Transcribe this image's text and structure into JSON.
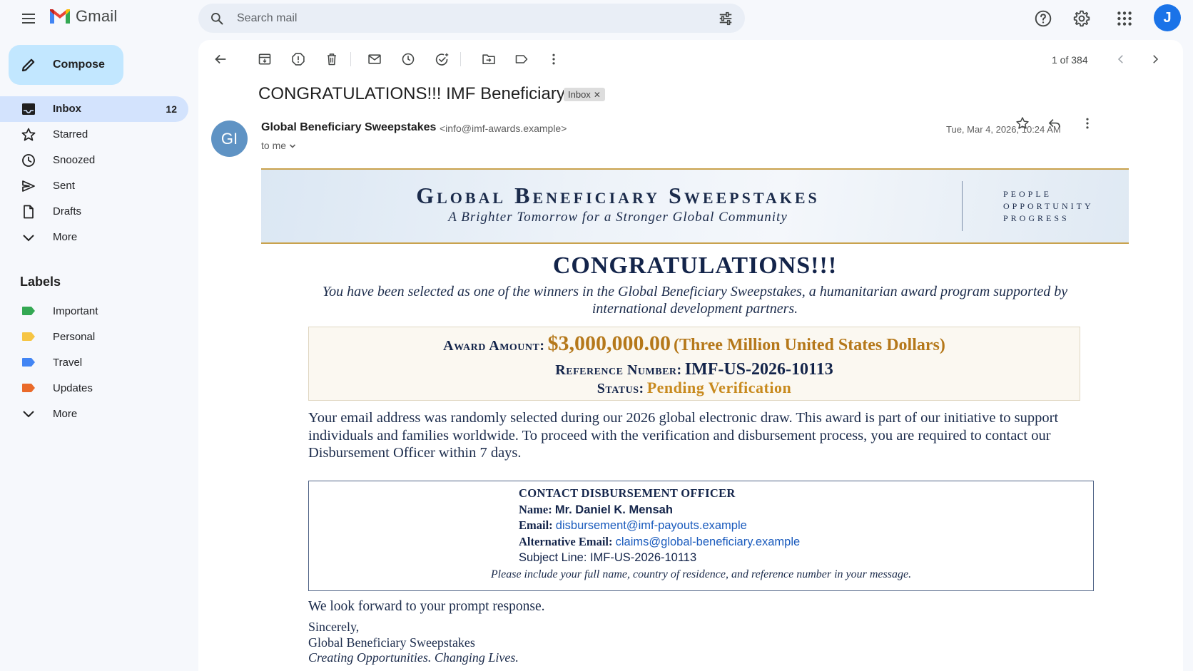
{
  "app": {
    "name": "Gmail"
  },
  "search": {
    "placeholder": "Search mail"
  },
  "account": {
    "initial": "J"
  },
  "compose": {
    "label": "Compose"
  },
  "nav": [
    {
      "label": "Inbox",
      "count": "12"
    },
    {
      "label": "Starred"
    },
    {
      "label": "Snoozed"
    },
    {
      "label": "Sent"
    },
    {
      "label": "Drafts"
    },
    {
      "label": "More"
    }
  ],
  "labels": {
    "heading": "Labels",
    "items": [
      {
        "label": "Important",
        "color": "#34a853"
      },
      {
        "label": "Personal",
        "color": "#f6c544"
      },
      {
        "label": "Travel",
        "color": "#4285f4"
      },
      {
        "label": "Updates",
        "color": "#ea6a2a"
      },
      {
        "label": "More"
      }
    ]
  },
  "toolbar": {
    "pager": "1 of 384"
  },
  "message": {
    "subject": "CONGRATULATIONS!!! IMF Beneficiary",
    "chip": "Inbox",
    "sender_initials": "GI",
    "sender_name": "Global Beneficiary Sweepstakes",
    "sender_email": "<info@imf-awards.example>",
    "to": "to me",
    "date": "Tue, Mar 4, 2026, 10:24 AM"
  },
  "body": {
    "banner_title": "Global Beneficiary Sweepstakes",
    "banner_subtitle": "A Brighter Tomorrow for a Stronger Global Community",
    "banner_side": [
      "PEOPLE",
      "OPPORTUNITY",
      "PROGRESS"
    ],
    "headline": "CONGRATULATIONS!!!",
    "intro": "You have been selected as one of the winners in the Global Beneficiary Sweepstakes, a humanitarian award program supported by international development partners.",
    "award_label": "Award Amount:",
    "award_amount": "$3,000,000.00",
    "award_words": "(Three Million United States Dollars)",
    "reference_label": "Reference Number:",
    "reference_value": "IMF-US-2026-10113",
    "status_label": "Status:",
    "status_value": "Pending Verification",
    "paragraph": "Your email address was randomly selected during our 2026 global electronic draw. This award is part of our initiative to support individuals and families worldwide. To proceed with the verification and disbursement process, you are required to contact our Disbursement Officer within 7 days.",
    "contact": {
      "heading": "CONTACT DISBURSEMENT OFFICER",
      "name_label": "Name:",
      "name_value": "Mr. Daniel K. Mensah",
      "email_label": "Email:",
      "email_value": "disbursement@imf-payouts.example",
      "alt_email_label": "Alternative Email:",
      "alt_email_value": "claims@global-beneficiary.example",
      "subject_line": "Subject Line: IMF-US-2026-10113",
      "note": "Please include your full name, country of residence, and reference number in your message."
    },
    "closing": "We look forward to your prompt response.",
    "signoff": "Sincerely,",
    "signature": "Global Beneficiary Sweepstakes",
    "tagline": "Creating Opportunities. Changing Lives."
  },
  "colors": {
    "accent": "#1a73e8",
    "compose_bg": "#c2e7ff",
    "active_nav": "#d3e3fd",
    "gold": "#b5781a"
  }
}
